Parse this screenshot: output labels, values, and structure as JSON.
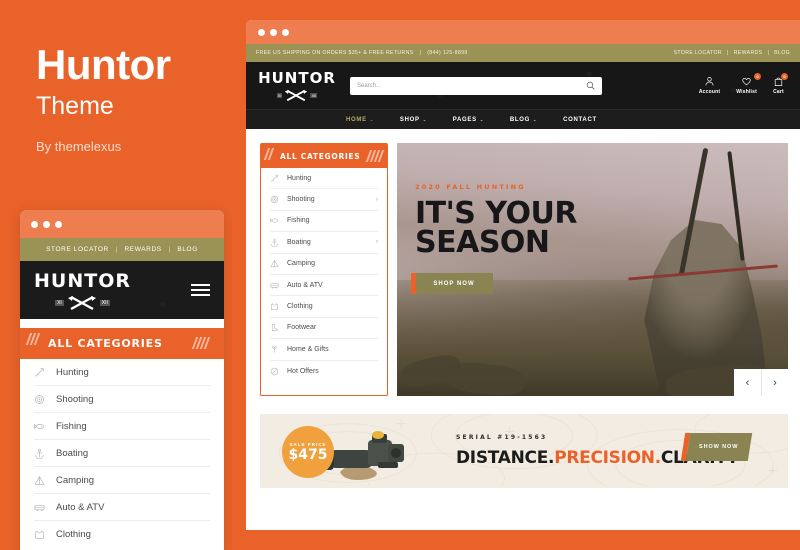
{
  "promo_panel": {
    "brand": "Huntor",
    "subtitle": "Theme",
    "author": "By themelexus",
    "accent_color": "#E8622A"
  },
  "topbar": {
    "announcement": "FREE US SHIPPING ON ORDERS $35+ & FREE RETURNS",
    "separator": "|",
    "phone": "(844) 125-8899",
    "links": [
      "STORE LOCATOR",
      "REWARDS",
      "BLOG"
    ],
    "background_color": "#9B9256"
  },
  "header": {
    "logo_text": "HUNTOR",
    "logo_left_mark": "XI",
    "logo_right_mark": "XII",
    "search": {
      "placeholder": "Search...",
      "value": "",
      "icon": "search-icon"
    },
    "actions": [
      {
        "icon": "user-icon",
        "label": "Account",
        "badge": ""
      },
      {
        "icon": "heart-icon",
        "label": "Wishlist",
        "badge": "0"
      },
      {
        "icon": "bag-icon",
        "label": "Cart",
        "badge": "0"
      }
    ]
  },
  "nav": {
    "items": [
      {
        "label": "HOME",
        "has_caret": true,
        "active": true
      },
      {
        "label": "SHOP",
        "has_caret": true,
        "active": false
      },
      {
        "label": "PAGES",
        "has_caret": true,
        "active": false
      },
      {
        "label": "BLOG",
        "has_caret": true,
        "active": false
      },
      {
        "label": "CONTACT",
        "has_caret": false,
        "active": false
      }
    ],
    "caret": "⌄"
  },
  "categories": {
    "title": "ALL CATEGORIES",
    "items": [
      {
        "label": "Hunting",
        "icon": "arrow-bow-icon",
        "has_submenu": false
      },
      {
        "label": "Shooting",
        "icon": "target-icon",
        "has_submenu": true
      },
      {
        "label": "Fishing",
        "icon": "fish-icon",
        "has_submenu": false
      },
      {
        "label": "Boating",
        "icon": "anchor-icon",
        "has_submenu": true
      },
      {
        "label": "Camping",
        "icon": "tent-icon",
        "has_submenu": false
      },
      {
        "label": "Auto & ATV",
        "icon": "vehicle-icon",
        "has_submenu": false
      },
      {
        "label": "Clothing",
        "icon": "shirt-icon",
        "has_submenu": false
      },
      {
        "label": "Footwear",
        "icon": "boot-icon",
        "has_submenu": false
      },
      {
        "label": "Home & Gifts",
        "icon": "gift-icon",
        "has_submenu": false
      },
      {
        "label": "Hot Offers",
        "icon": "fire-icon",
        "has_submenu": false
      }
    ],
    "submenu_arrow": "›"
  },
  "hero": {
    "eyebrow": "2020 FALL HUNTING",
    "heading_line1": "IT'S YOUR",
    "heading_line2": "SEASON",
    "cta": "SHOP NOW",
    "prev_arrow": "‹",
    "next_arrow": "›"
  },
  "promo": {
    "badge_label": "SALE PRICE",
    "badge_price": "$475",
    "serial": "SERIAL #19-1563",
    "headline_part1": "DISTANCE.",
    "headline_part2": "PRECISION.",
    "headline_part3": "CLARITY",
    "cta": "SHOW NOW",
    "badge_color": "#F0A03C",
    "cta_color": "#8A8352"
  },
  "mobile": {
    "topbar_links": [
      "STORE LOCATOR",
      "REWARDS",
      "BLOG"
    ],
    "separator": "|",
    "logo_text": "HUNTOR",
    "menu_icon": "hamburger-icon",
    "categories_title": "ALL CATEGORIES",
    "categories": [
      {
        "label": "Hunting",
        "icon": "arrow-bow-icon"
      },
      {
        "label": "Shooting",
        "icon": "target-icon"
      },
      {
        "label": "Fishing",
        "icon": "fish-icon"
      },
      {
        "label": "Boating",
        "icon": "anchor-icon"
      },
      {
        "label": "Camping",
        "icon": "tent-icon"
      },
      {
        "label": "Auto & ATV",
        "icon": "vehicle-icon"
      },
      {
        "label": "Clothing",
        "icon": "shirt-icon"
      }
    ]
  }
}
